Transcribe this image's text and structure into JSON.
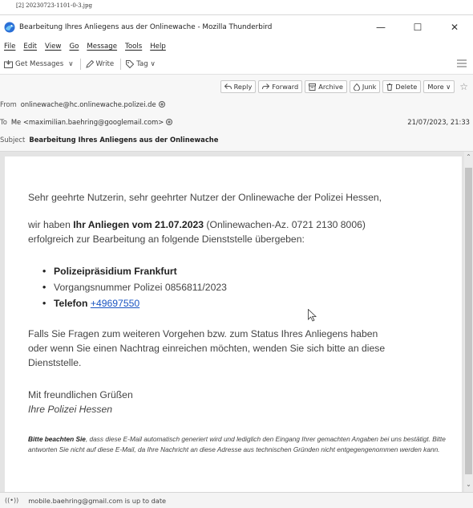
{
  "image_label": "[2] 20230723-1101-0-3.jpg",
  "window": {
    "title": "Bearbeitung Ihres Anliegens aus der Onlinewache - Mozilla Thunderbird",
    "minimize": "—",
    "maximize": "☐",
    "close": "✕"
  },
  "menu": [
    "File",
    "Edit",
    "View",
    "Go",
    "Message",
    "Tools",
    "Help"
  ],
  "toolbar": {
    "get_messages": "Get Messages",
    "dropdown": "∨",
    "write": "Write",
    "tag": "Tag ∨"
  },
  "header": {
    "actions": [
      "Reply",
      "Forward",
      "Archive",
      "Junk",
      "Delete",
      "More ∨"
    ],
    "from_label": "From",
    "from_value": "onlinewache@hc.onlinewache.polizei.de",
    "to_label": "To",
    "to_value": "Me <maximilian.baehring@googlemail.com>",
    "date": "21/07/2023, 21:33",
    "subject_label": "Subject",
    "subject_value": "Bearbeitung Ihres Anliegens aus der Onlinewache"
  },
  "body": {
    "greeting": "Sehr geehrte Nutzerin, sehr geehrter Nutzer der Onlinewache der Polizei Hessen,",
    "p1_a": "wir haben ",
    "p1_bold": "Ihr Anliegen vom 21.07.2023",
    "p1_b": " (Onlinewachen-Az. 0721 2130 8006)",
    "p1_line2": "erfolgreich zur Bearbeitung an folgende Dienststelle übergeben:",
    "b1": "Polizeipräsidium Frankfurt",
    "b2": "Vorgangsnummer Polizei 0856811/2023",
    "b3_label": "Telefon ",
    "b3_link": "+49697550",
    "p2_line1": "Falls Sie Fragen zum weiteren Vorgehen bzw. zum Status Ihres Anliegens haben",
    "p2_line2": "oder wenn Sie einen Nachtrag einreichen möchten, wenden Sie sich bitte an diese",
    "p2_line3": "Dienststelle.",
    "closing1": "Mit freundlichen Grüßen",
    "closing2": "Ihre Polizei Hessen",
    "note_bold": "Bitte beachten Sie",
    "note_text": ", dass diese E-Mail automatisch generiert wird und lediglich den Eingang Ihrer gemachten Angaben bei uns bestätigt. Bitte antworten Sie nicht auf diese E-Mail, da Ihre Nachricht an diese Adresse aus technischen Gründen nicht entgegengenommen werden kann."
  },
  "status": {
    "icon": "((•))",
    "text": "mobile.baehring@gmail.com is up to date"
  }
}
